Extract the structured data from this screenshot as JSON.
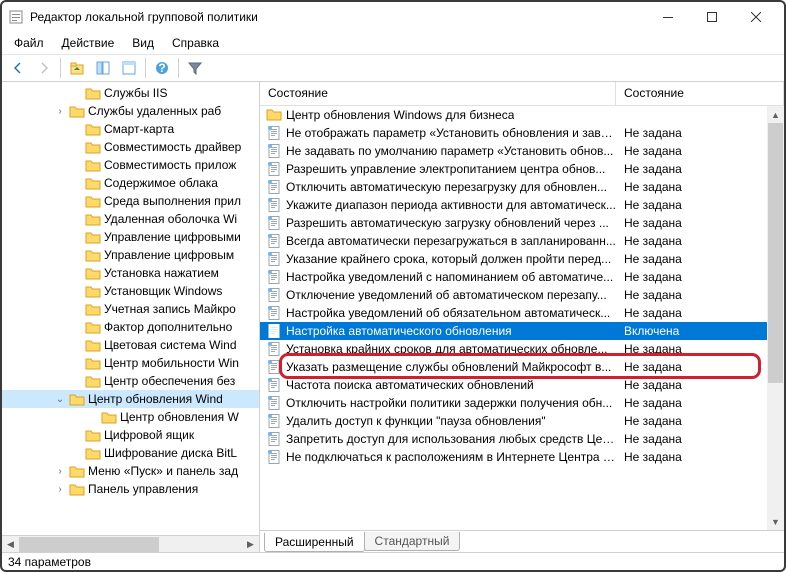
{
  "window": {
    "title": "Редактор локальной групповой политики"
  },
  "menu": [
    "Файл",
    "Действие",
    "Вид",
    "Справка"
  ],
  "columns": {
    "c1": "Состояние",
    "c2": "Состояние"
  },
  "tree": [
    {
      "d": 4,
      "e": "",
      "l": "Службы IIS"
    },
    {
      "d": 3,
      "e": "›",
      "l": "Службы удаленных раб"
    },
    {
      "d": 4,
      "e": "",
      "l": "Смарт-карта"
    },
    {
      "d": 4,
      "e": "",
      "l": "Совместимость драйвер"
    },
    {
      "d": 4,
      "e": "",
      "l": "Совместимость прилож"
    },
    {
      "d": 4,
      "e": "",
      "l": "Содержимое облака"
    },
    {
      "d": 4,
      "e": "",
      "l": "Среда выполнения прил"
    },
    {
      "d": 4,
      "e": "",
      "l": "Удаленная оболочка Wi"
    },
    {
      "d": 4,
      "e": "",
      "l": "Управление цифровыми"
    },
    {
      "d": 4,
      "e": "",
      "l": "Управление цифровым"
    },
    {
      "d": 4,
      "e": "",
      "l": "Установка нажатием"
    },
    {
      "d": 4,
      "e": "",
      "l": "Установщик Windows"
    },
    {
      "d": 4,
      "e": "",
      "l": "Учетная запись Майкро"
    },
    {
      "d": 4,
      "e": "",
      "l": "Фактор дополнительно"
    },
    {
      "d": 4,
      "e": "",
      "l": "Цветовая система Wind"
    },
    {
      "d": 4,
      "e": "",
      "l": "Центр мобильности Win"
    },
    {
      "d": 4,
      "e": "",
      "l": "Центр обеспечения без"
    },
    {
      "d": 3,
      "e": "⌄",
      "l": "Центр обновления Wind",
      "sel": true
    },
    {
      "d": 5,
      "e": "",
      "l": "Центр обновления W"
    },
    {
      "d": 4,
      "e": "",
      "l": "Цифровой ящик"
    },
    {
      "d": 4,
      "e": "",
      "l": "Шифрование диска BitL"
    },
    {
      "d": 3,
      "e": "›",
      "l": "Меню «Пуск» и панель зад"
    },
    {
      "d": 3,
      "e": "›",
      "l": "Панель управления"
    }
  ],
  "rows": [
    {
      "t": "folder",
      "text": "Центр обновления Windows для бизнеса",
      "state": ""
    },
    {
      "t": "item",
      "text": "Не отображать параметр «Установить обновления и заве...",
      "state": "Не задана"
    },
    {
      "t": "item",
      "text": "Не задавать по умолчанию параметр «Установить обнов...",
      "state": "Не задана"
    },
    {
      "t": "item",
      "text": "Разрешить управление электропитанием центра обнов...",
      "state": "Не задана"
    },
    {
      "t": "item",
      "text": "Отключить автоматическую перезагрузку для обновлен...",
      "state": "Не задана"
    },
    {
      "t": "item",
      "text": "Укажите диапазон периода активности для автоматическ...",
      "state": "Не задана"
    },
    {
      "t": "item",
      "text": "Разрешить автоматическую загрузку обновлений через ...",
      "state": "Не задана"
    },
    {
      "t": "item",
      "text": "Всегда автоматически перезагружаться в запланированн...",
      "state": "Не задана"
    },
    {
      "t": "item",
      "text": "Указание крайнего срока, который должен пройти перед...",
      "state": "Не задана"
    },
    {
      "t": "item",
      "text": "Настройка уведомлений с напоминанием об автоматиче...",
      "state": "Не задана"
    },
    {
      "t": "item",
      "text": "Отключение уведомлений об автоматическом перезапу...",
      "state": "Не задана"
    },
    {
      "t": "item",
      "text": "Настройка уведомлений об обязательном автоматическ...",
      "state": "Не задана"
    },
    {
      "t": "item",
      "text": "Настройка автоматического обновления",
      "state": "Включена",
      "sel": true
    },
    {
      "t": "item",
      "text": "Установка крайних сроков для автоматических обновле...",
      "state": "Не задана"
    },
    {
      "t": "item",
      "text": "Указать размещение службы обновлений Майкрософт в...",
      "state": "Не задана"
    },
    {
      "t": "item",
      "text": "Частота поиска автоматических обновлений",
      "state": "Не задана"
    },
    {
      "t": "item",
      "text": "Отключить настройки политики задержки получения обн...",
      "state": "Не задана"
    },
    {
      "t": "item",
      "text": "Удалить доступ к функции \"пауза обновления\"",
      "state": "Не задана"
    },
    {
      "t": "item",
      "text": "Запретить доступ для использования любых средств Цен...",
      "state": "Не задана"
    },
    {
      "t": "item",
      "text": "Не подключаться к расположениям в Интернете Центра о...",
      "state": "Не задана"
    }
  ],
  "tabs": {
    "active": "Расширенный",
    "inactive": "Стандартный"
  },
  "status": "34 параметров",
  "icons": {
    "folder_fill": "#ffd96a",
    "folder_stroke": "#d9a420",
    "doc_fill": "#ffffff",
    "doc_stroke": "#9aa6b2"
  }
}
